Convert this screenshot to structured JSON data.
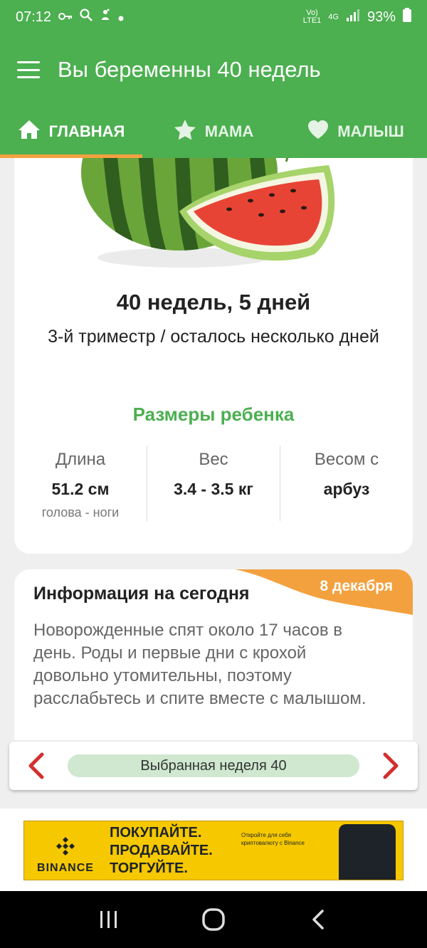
{
  "status_bar": {
    "time": "07:12",
    "network_top": "Vo)",
    "network_bottom": "LTE1",
    "signal_type": "4G",
    "battery": "93%"
  },
  "app_bar": {
    "title": "Вы беременны 40 недель"
  },
  "tabs": [
    {
      "label": "ГЛАВНАЯ",
      "icon": "home-icon",
      "active": true
    },
    {
      "label": "МАМА",
      "icon": "star-icon",
      "active": false
    },
    {
      "label": "МАЛЫШ",
      "icon": "heart-icon",
      "active": false
    }
  ],
  "pregnancy": {
    "week_title": "40 недель, 5 дней",
    "trimester": "3-й триместр / осталось несколько дней",
    "fruit_image": "watermelon"
  },
  "baby_sizes": {
    "title": "Размеры ребенка",
    "length": {
      "label": "Длина",
      "value": "51.2 см",
      "sub": "голова - ноги"
    },
    "weight": {
      "label": "Вес",
      "value": "3.4 - 3.5 кг"
    },
    "size_like": {
      "label": "Весом с",
      "value": "арбуз"
    }
  },
  "info_today": {
    "title": "Информация на сегодня",
    "date": "8 декабря",
    "text": "Новорожденные спят около 17 часов в день. Роды и первые дни с крохой довольно утомительны, поэтому расслабьтесь и спите вместе с малышом."
  },
  "week_nav": {
    "selected_label": "Выбранная неделя 40"
  },
  "ad": {
    "brand": "BINANCE",
    "line1": "ПОКУПАЙТЕ.",
    "line2": "ПРОДАВАЙТЕ.",
    "line3": "ТОРГУЙТЕ.",
    "small_text": "Откройте для себя криптовалюту с Binance"
  },
  "colors": {
    "primary_green": "#4caf50",
    "accent_orange": "#f3a13f",
    "nav_arrow_red": "#d32f2f",
    "pill_green": "#cfe8cf"
  }
}
